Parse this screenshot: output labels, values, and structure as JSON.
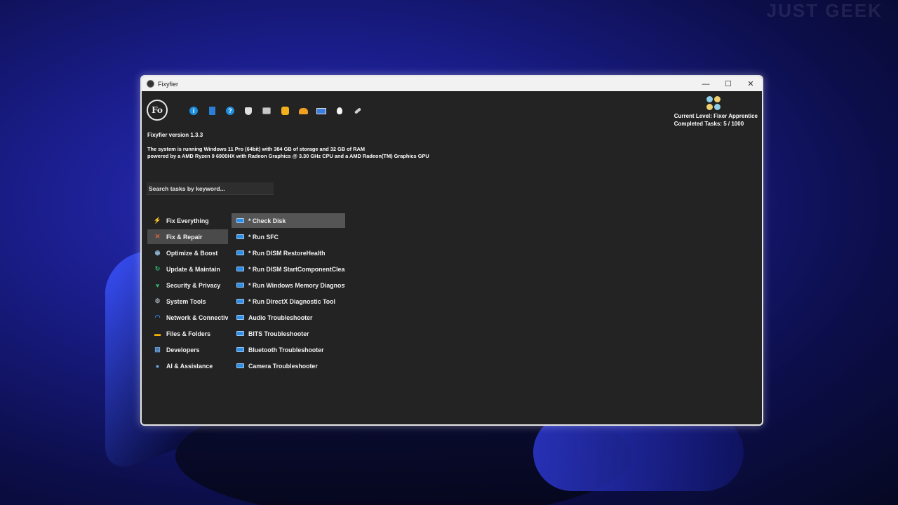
{
  "watermark": "JUST GEEK",
  "window": {
    "title": "Fixyfier",
    "controls": {
      "minimize": "—",
      "maximize": "☐",
      "close": "✕"
    }
  },
  "logo_text": "Fo",
  "toolbar": [
    {
      "name": "info-icon",
      "glyph": "i"
    },
    {
      "name": "book-icon",
      "glyph": ""
    },
    {
      "name": "help-icon",
      "glyph": "?"
    },
    {
      "name": "coffee-icon",
      "glyph": ""
    },
    {
      "name": "shop-icon",
      "glyph": ""
    },
    {
      "name": "thumbs-up-icon",
      "glyph": ""
    },
    {
      "name": "donate-icon",
      "glyph": ""
    },
    {
      "name": "screen-icon",
      "glyph": ""
    },
    {
      "name": "lightbulb-icon",
      "glyph": ""
    },
    {
      "name": "brush-icon",
      "glyph": ""
    }
  ],
  "level": {
    "current": "Current Level: Fixer Apprentice",
    "completed": "Completed Tasks: 5 / 1000"
  },
  "version": "Fixyfier version 1.3.3",
  "sysinfo": {
    "line1": "The system is running Windows 11 Pro (64bit) with 384 GB of storage and 32 GB of RAM",
    "line2": "powered by a AMD Ryzen 9 6900HX with Radeon Graphics @ 3.30 GHz CPU and a AMD Radeon(TM) Graphics GPU"
  },
  "search": {
    "placeholder": "Search tasks by keyword..."
  },
  "categories": [
    {
      "label": "Fix Everything",
      "icon": "lightning-icon",
      "glyph": "⚡",
      "color": "#f5b400",
      "active": false
    },
    {
      "label": "Fix & Repair",
      "icon": "tools-icon",
      "glyph": "✕",
      "color": "#e06a3a",
      "active": true
    },
    {
      "label": "Optimize & Boost",
      "icon": "gauge-icon",
      "glyph": "◉",
      "color": "#8fb8d8",
      "active": false
    },
    {
      "label": "Update & Maintain",
      "icon": "refresh-icon",
      "glyph": "↻",
      "color": "#2fb874",
      "active": false
    },
    {
      "label": "Security & Privacy",
      "icon": "shield-icon",
      "glyph": "♥",
      "color": "#2fb874",
      "active": false
    },
    {
      "label": "System Tools",
      "icon": "gear-icon",
      "glyph": "⚙",
      "color": "#a0aab4",
      "active": false
    },
    {
      "label": "Network & Connectivity",
      "icon": "wifi-icon",
      "glyph": "◠",
      "color": "#2f8fe6",
      "active": false
    },
    {
      "label": "Files & Folders",
      "icon": "folder-icon",
      "glyph": "▬",
      "color": "#f5b400",
      "active": false
    },
    {
      "label": "Developers",
      "icon": "document-icon",
      "glyph": "▤",
      "color": "#6aa8e8",
      "active": false
    },
    {
      "label": "AI & Assistance",
      "icon": "ai-head-icon",
      "glyph": "●",
      "color": "#6aa8e8",
      "active": false
    }
  ],
  "tasks": [
    {
      "label": "* Check Disk",
      "active": true
    },
    {
      "label": "* Run SFC",
      "active": false
    },
    {
      "label": "* Run DISM RestoreHealth",
      "active": false
    },
    {
      "label": "* Run DISM StartComponentCleanup",
      "active": false
    },
    {
      "label": "* Run Windows Memory Diagnostic",
      "active": false
    },
    {
      "label": "* Run DirectX Diagnostic Tool",
      "active": false
    },
    {
      "label": "Audio Troubleshooter",
      "active": false
    },
    {
      "label": "BITS Troubleshooter",
      "active": false
    },
    {
      "label": "Bluetooth Troubleshooter",
      "active": false
    },
    {
      "label": "Camera Troubleshooter",
      "active": false
    }
  ]
}
